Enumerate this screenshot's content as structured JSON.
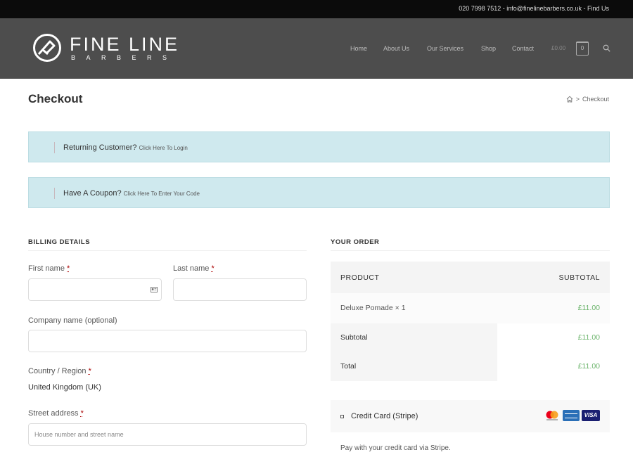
{
  "topbar": {
    "contact": "020 7998 7512 - info@finelinebarbers.co.uk - Find Us"
  },
  "logo": {
    "main": "FINE LINE",
    "sub": "BARBERS"
  },
  "nav": [
    "Home",
    "About Us",
    "Our Services",
    "Shop",
    "Contact"
  ],
  "cart": {
    "price": "£0.00",
    "count": "0"
  },
  "page": {
    "title": "Checkout",
    "breadcrumb_current": "Checkout",
    "breadcrumb_sep": ">"
  },
  "notices": {
    "returning": {
      "text": "Returning Customer?",
      "link": "Click Here To Login"
    },
    "coupon": {
      "text": "Have A Coupon?",
      "link": "Click Here To Enter Your Code"
    }
  },
  "billing": {
    "heading": "BILLING DETAILS",
    "first_name_label": "First name",
    "last_name_label": "Last name",
    "company_label": "Company name (optional)",
    "country_label": "Country / Region",
    "country_value": "United Kingdom (UK)",
    "street_label": "Street address",
    "street_placeholder": "House number and street name",
    "required_mark": "*"
  },
  "order": {
    "heading": "YOUR ORDER",
    "col_product": "PRODUCT",
    "col_subtotal": "SUBTOTAL",
    "item_name": "Deluxe Pomade",
    "item_qty": "× 1",
    "item_price": "£11.00",
    "subtotal_label": "Subtotal",
    "subtotal_value": "£11.00",
    "total_label": "Total",
    "total_value": "£11.00"
  },
  "payment": {
    "method": "Credit Card (Stripe)",
    "note": "Pay with your credit card via Stripe.",
    "visa": "VISA"
  }
}
